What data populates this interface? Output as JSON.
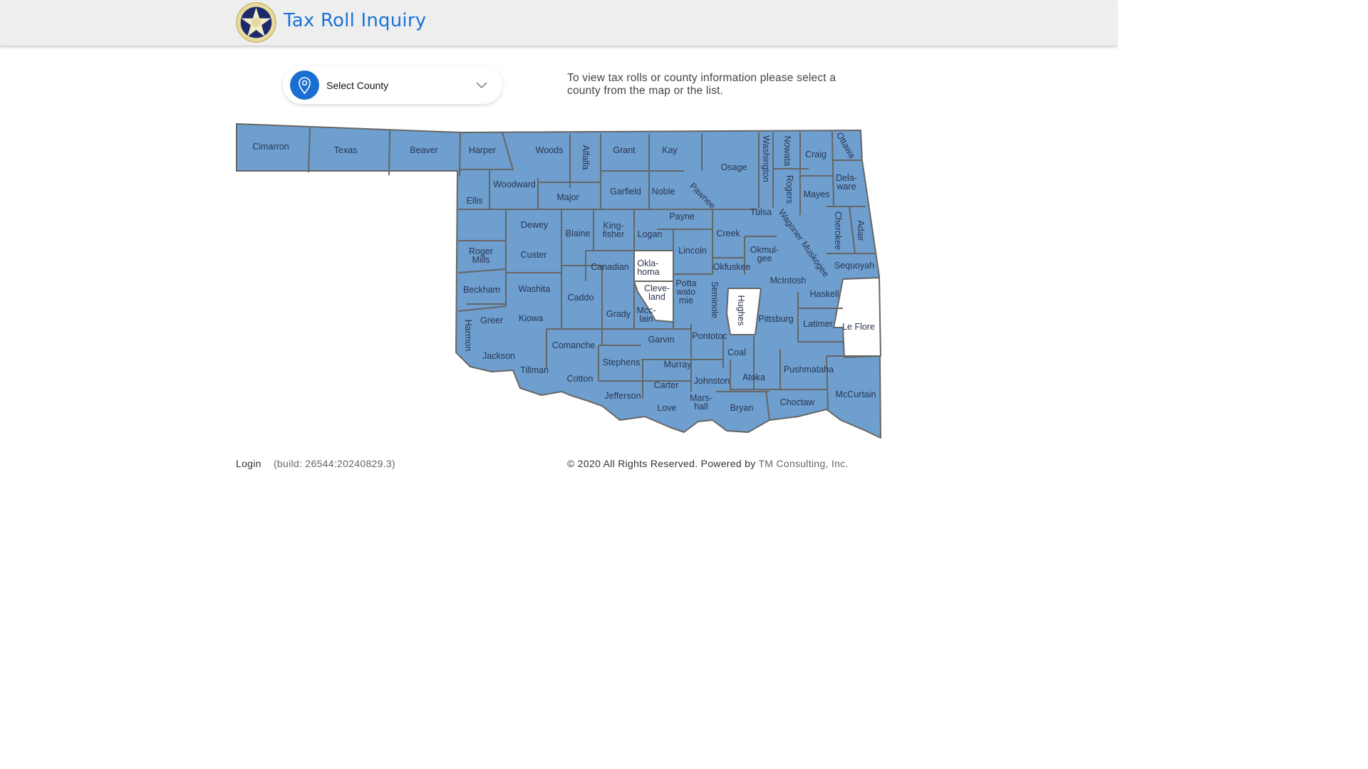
{
  "header": {
    "title": "Tax Roll Inquiry",
    "logo": "Great Seal of the State of Oklahoma 1907"
  },
  "county_select": {
    "placeholder": "Select County",
    "icon": "map-pin-icon"
  },
  "info_text": "To view tax rolls or county information please select a county from the map or the list.",
  "colors": {
    "county_fill": "#6e9fcf",
    "county_border": "#666666",
    "selected_fill": "#ffffff",
    "accent": "#1a6fd1"
  },
  "highlighted_counties": [
    "Okla-homa",
    "Cleve-land",
    "Hughes",
    "Le Flore"
  ],
  "counties": [
    "Cimarron",
    "Texas",
    "Beaver",
    "Harper",
    "Woods",
    "Alfalfa",
    "Grant",
    "Kay",
    "Osage",
    "Washington",
    "Nowata",
    "Craig",
    "Ottawa",
    "Ellis",
    "Woodward",
    "Major",
    "Garfield",
    "Noble",
    "Pawnee",
    "Rogers",
    "Mayes",
    "Dela-\nware",
    "Dewey",
    "Blaine",
    "King-\nfisher",
    "Logan",
    "Payne",
    "Tulsa",
    "Creek",
    "Wagoner",
    "Cherokee",
    "Adair",
    "Roger\nMills",
    "Custer",
    "Canadian",
    "Okla-\nhoma",
    "Lincoln",
    "Okmul-\ngee",
    "Muskogee",
    "Sequoyah",
    "Beckham",
    "Washita",
    "Caddo",
    "Grady",
    "Cleve-\nland",
    "Mcc-\nlain",
    "Potta\nwato\nmie",
    "Seminole",
    "Okfuskee",
    "McIntosh",
    "Haskell",
    "Hughes",
    "Pittsburg",
    "Latimer",
    "Le Flore",
    "Harmon",
    "Greer",
    "Kiowa",
    "Jackson",
    "Comanche",
    "Tillman",
    "Cotton",
    "Stephens",
    "Garvin",
    "Murray",
    "Pontotoc",
    "Coal",
    "Atoka",
    "Pushmataha",
    "McCurtain",
    "Jefferson",
    "Carter",
    "Johnston",
    "Mars-\nhall",
    "Love",
    "Bryan",
    "Choctaw"
  ],
  "footer": {
    "login": "Login",
    "build": "(build: 26544:20240829.3)",
    "copyright": "© 2020 All Rights Reserved. Powered by",
    "company": "TM Consulting, Inc."
  }
}
